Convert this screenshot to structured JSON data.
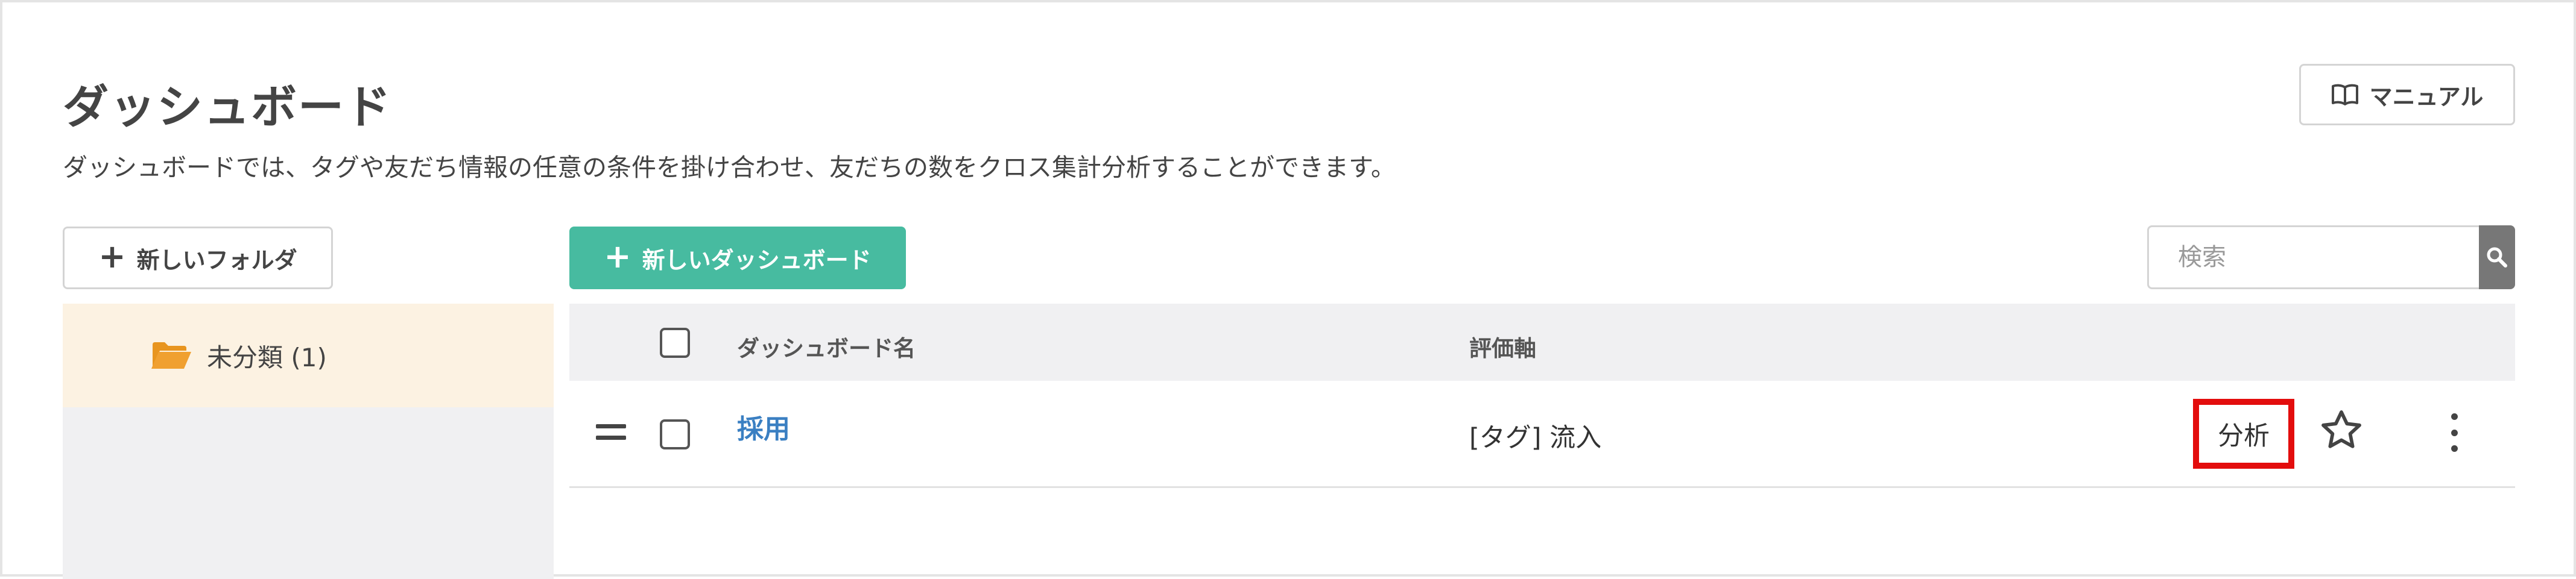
{
  "header": {
    "title": "ダッシュボード",
    "subtitle": "ダッシュボードでは、タグや友だち情報の任意の条件を掛け合わせ、友だちの数をクロス集計分析することができます。",
    "manual_button": "マニュアル",
    "manual_icon": "book-icon"
  },
  "toolbar": {
    "new_folder": "新しいフォルダ",
    "new_dashboard": "新しいダッシュボード",
    "plus_symbol": "+",
    "search_placeholder": "検索",
    "search_icon": "magnifier-icon"
  },
  "sidebar": {
    "folders": [
      {
        "label": "未分類 (1)",
        "icon": "folder-open-icon",
        "selected": true
      }
    ]
  },
  "table": {
    "columns": [
      "ダッシュボード名",
      "評価軸"
    ],
    "rows": [
      {
        "name": "採用",
        "axis": "[タグ] 流入",
        "analyze": "分析"
      }
    ]
  },
  "colors": {
    "primary": "#47bba0",
    "link": "#3a7fc2",
    "highlight": "#e30d0d",
    "folder_selected": "#fcf2e2",
    "folder_icon": "#f0a030"
  }
}
